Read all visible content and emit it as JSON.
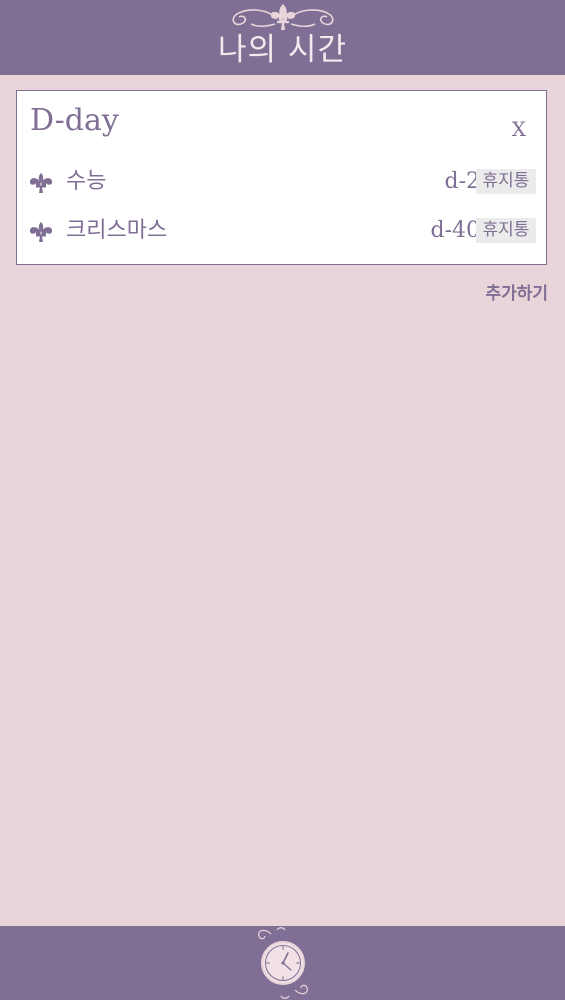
{
  "header": {
    "title": "나의 시간",
    "ornament_icon": "fleur-ornament-icon"
  },
  "dday_panel": {
    "title": "D-day",
    "close_label": "X",
    "items": [
      {
        "icon": "fleur-de-lis-icon",
        "name": "수능",
        "dday": "d-2",
        "delete_label": "휴지통"
      },
      {
        "icon": "fleur-de-lis-icon",
        "name": "크리스마스",
        "dday": "d-40",
        "delete_label": "휴지통"
      }
    ]
  },
  "add_label": "추가하기",
  "footer": {
    "clock_icon": "clock-icon"
  },
  "colors": {
    "accent": "#806f94",
    "background": "#e9d4da",
    "panel": "#ffffff",
    "trash_bg": "#ebebeb",
    "header_text": "#f4e9ee"
  }
}
